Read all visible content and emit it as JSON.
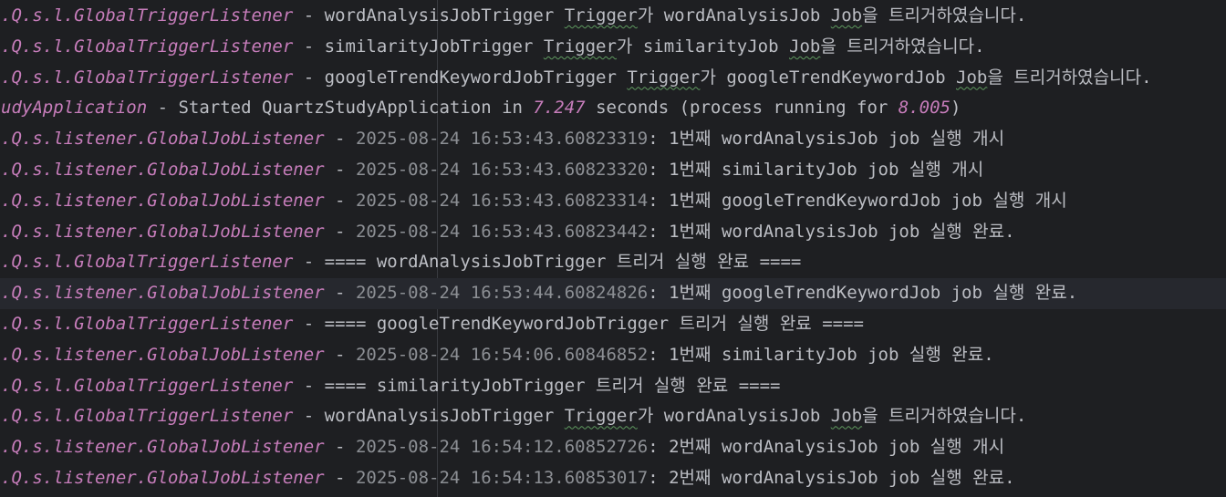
{
  "console": {
    "lines": [
      {
        "logger": ".Q.s.l.GlobalTriggerListener",
        "sep": " - ",
        "segments": [
          {
            "t": "wordAnalysisJobTrigger "
          },
          {
            "t": "Trigger",
            "sq": true
          },
          {
            "t": "가 wordAnalysisJob "
          },
          {
            "t": "Job",
            "sq": true
          },
          {
            "t": "을 트리거하였습니다."
          }
        ]
      },
      {
        "logger": ".Q.s.l.GlobalTriggerListener",
        "sep": " - ",
        "segments": [
          {
            "t": "similarityJobTrigger "
          },
          {
            "t": "Trigger",
            "sq": true
          },
          {
            "t": "가 similarityJob "
          },
          {
            "t": "Job",
            "sq": true
          },
          {
            "t": "을 트리거하였습니다."
          }
        ]
      },
      {
        "logger": ".Q.s.l.GlobalTriggerListener",
        "sep": " - ",
        "segments": [
          {
            "t": "googleTrendKeywordJobTrigger "
          },
          {
            "t": "Trigger",
            "sq": true
          },
          {
            "t": "가 googleTrendKeywordJob "
          },
          {
            "t": "Job",
            "sq": true
          },
          {
            "t": "을 트리거하였습니다."
          }
        ]
      },
      {
        "logger": "udyApplication",
        "sep": " - ",
        "segments": [
          {
            "t": "Started QuartzStudyApplication in "
          },
          {
            "t": "7.247",
            "num": true
          },
          {
            "t": " seconds (process running for "
          },
          {
            "t": "8.005",
            "num": true
          },
          {
            "t": ")"
          }
        ]
      },
      {
        "logger": ".Q.s.listener.GlobalJobListener",
        "sep": " - ",
        "segments": [
          {
            "t": "2025-08-24 16:53:43.60823319",
            "ts": true
          },
          {
            "t": ": 1번째 wordAnalysisJob job 실행 개시"
          }
        ]
      },
      {
        "logger": ".Q.s.listener.GlobalJobListener",
        "sep": " - ",
        "segments": [
          {
            "t": "2025-08-24 16:53:43.60823320",
            "ts": true
          },
          {
            "t": ": 1번째 similarityJob job 실행 개시"
          }
        ]
      },
      {
        "logger": ".Q.s.listener.GlobalJobListener",
        "sep": " - ",
        "segments": [
          {
            "t": "2025-08-24 16:53:43.60823314",
            "ts": true
          },
          {
            "t": ": 1번째 googleTrendKeywordJob job 실행 개시"
          }
        ]
      },
      {
        "logger": ".Q.s.listener.GlobalJobListener",
        "sep": " - ",
        "segments": [
          {
            "t": "2025-08-24 16:53:43.60823442",
            "ts": true
          },
          {
            "t": ": 1번째 wordAnalysisJob job 실행 완료."
          }
        ]
      },
      {
        "logger": ".Q.s.l.GlobalTriggerListener",
        "sep": " - ",
        "segments": [
          {
            "t": "==== wordAnalysisJobTrigger 트리거 실행 완료 ===="
          }
        ]
      },
      {
        "logger": ".Q.s.listener.GlobalJobListener",
        "sep": " - ",
        "highlight": true,
        "segments": [
          {
            "t": "2025-08-24 16:53:44.60824826",
            "ts": true
          },
          {
            "t": ": 1번째 googleTrendKeywordJob job 실행 완료."
          }
        ]
      },
      {
        "logger": ".Q.s.l.GlobalTriggerListener",
        "sep": " - ",
        "segments": [
          {
            "t": "==== googleTrendKeywordJobTrigger 트리거 실행 완료 ===="
          }
        ]
      },
      {
        "logger": ".Q.s.listener.GlobalJobListener",
        "sep": " - ",
        "segments": [
          {
            "t": "2025-08-24 16:54:06.60846852",
            "ts": true
          },
          {
            "t": ": 1번째 similarityJob job 실행 완료."
          }
        ]
      },
      {
        "logger": ".Q.s.l.GlobalTriggerListener",
        "sep": " - ",
        "segments": [
          {
            "t": "==== similarityJobTrigger 트리거 실행 완료 ===="
          }
        ]
      },
      {
        "logger": ".Q.s.l.GlobalTriggerListener",
        "sep": " - ",
        "segments": [
          {
            "t": "wordAnalysisJobTrigger "
          },
          {
            "t": "Trigger",
            "sq": true
          },
          {
            "t": "가 wordAnalysisJob "
          },
          {
            "t": "Job",
            "sq": true
          },
          {
            "t": "을 트리거하였습니다."
          }
        ]
      },
      {
        "logger": ".Q.s.listener.GlobalJobListener",
        "sep": " - ",
        "segments": [
          {
            "t": "2025-08-24 16:54:12.60852726",
            "ts": true
          },
          {
            "t": ": 2번째 wordAnalysisJob job 실행 개시"
          }
        ]
      },
      {
        "logger": ".Q.s.listener.GlobalJobListener",
        "sep": " - ",
        "segments": [
          {
            "t": "2025-08-24 16:54:13.60853017",
            "ts": true
          },
          {
            "t": ": 2번째 wordAnalysisJob job 실행 완료."
          }
        ]
      }
    ]
  }
}
